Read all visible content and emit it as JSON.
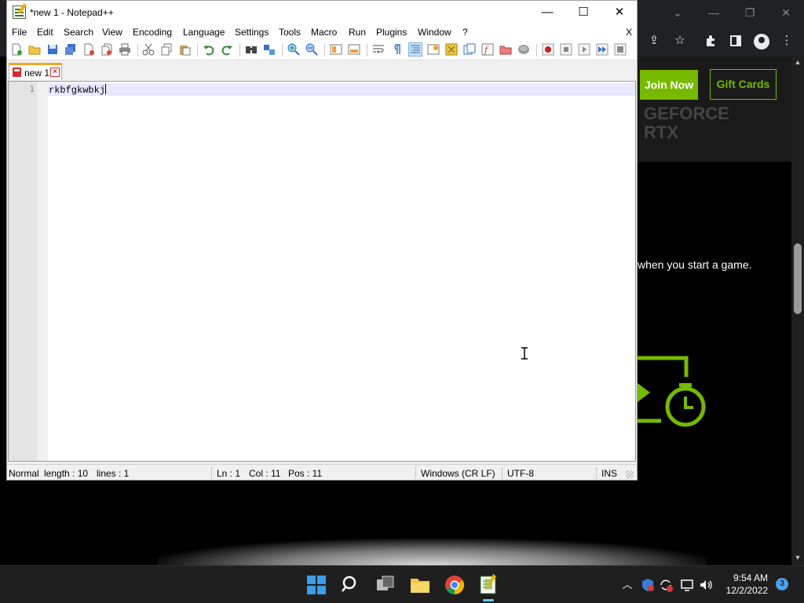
{
  "browser": {
    "join_label": "Join Now",
    "gift_label": "Gift Cards",
    "hero_line1": "GEFORCE",
    "hero_line2": "RTX",
    "promo_text": "when you start a game."
  },
  "notepad": {
    "title": "*new 1 - Notepad++",
    "menu": [
      "File",
      "Edit",
      "Search",
      "View",
      "Encoding",
      "Language",
      "Settings",
      "Tools",
      "Macro",
      "Run",
      "Plugins",
      "Window",
      "?"
    ],
    "menu_close": "X",
    "tab": {
      "label": "new 1"
    },
    "editor": {
      "line_number": "1",
      "content": "rkbfgkwbkj"
    },
    "status": {
      "mode": "Normal",
      "length": "length : 10",
      "lines": "lines : 1",
      "ln": "Ln : 1",
      "col": "Col : 11",
      "pos": "Pos : 11",
      "eol": "Windows (CR LF)",
      "encoding": "UTF-8",
      "ins": "INS"
    }
  },
  "taskbar": {
    "time": "9:54 AM",
    "date": "12/2/2022",
    "notification_count": "3"
  },
  "colors": {
    "nvidia_green": "#76b900",
    "tab_accent": "#f5a623",
    "taskbar": "#1f1f1f"
  }
}
